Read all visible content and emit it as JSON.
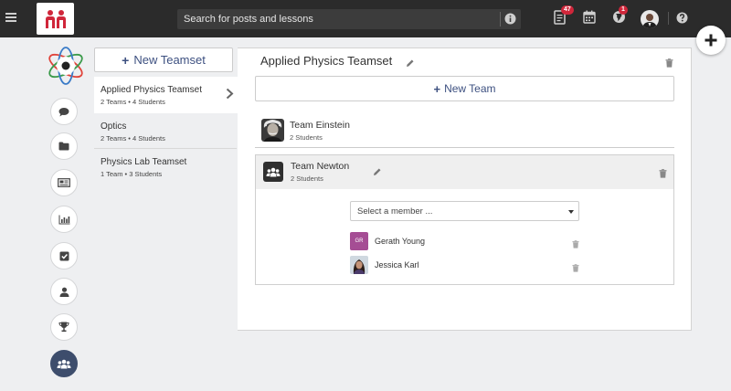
{
  "topbar": {
    "search_placeholder": "Search for posts and lessons",
    "notifications_badge": "47",
    "world_badge": "1",
    "icons": [
      "menu-icon",
      "app-logo-icon",
      "info-icon",
      "document-icon",
      "calendar-icon",
      "globe-icon",
      "help-icon"
    ]
  },
  "fab": {
    "icon": "plus-icon"
  },
  "nav": {
    "items": [
      "chat-icon",
      "folder-icon",
      "newspaper-icon",
      "bar-chart-icon",
      "checkbox-icon",
      "user-icon",
      "trophy-icon",
      "group-icon"
    ],
    "active": "group-icon"
  },
  "teamsets": {
    "new_label": "New Teamset",
    "items": [
      {
        "name": "Applied Physics Teamset",
        "meta": "2 Teams • 4 Students",
        "active": true
      },
      {
        "name": "Optics",
        "meta": "2 Teams • 4 Students",
        "active": false
      },
      {
        "name": "Physics Lab Teamset",
        "meta": "1 Team • 3 Students",
        "active": false
      }
    ]
  },
  "panel": {
    "title": "Applied Physics Teamset",
    "new_team_label": "New Team",
    "teams": [
      {
        "name": "Team Einstein",
        "count": "2 Students"
      },
      {
        "name": "Team Newton",
        "count": "2 Students"
      }
    ],
    "select_placeholder": "Select a member ...",
    "members": [
      {
        "initials": "GR",
        "name": "Gerath Young"
      },
      {
        "initials": "",
        "name": "Jessica Karl"
      }
    ]
  },
  "colors": {
    "topbar": "#2b2b2b",
    "accent_blue": "#3d5080",
    "badge_red": "#d0263a",
    "active_nav": "#3d4d6c",
    "member_initials_bg": "#a54d94"
  }
}
